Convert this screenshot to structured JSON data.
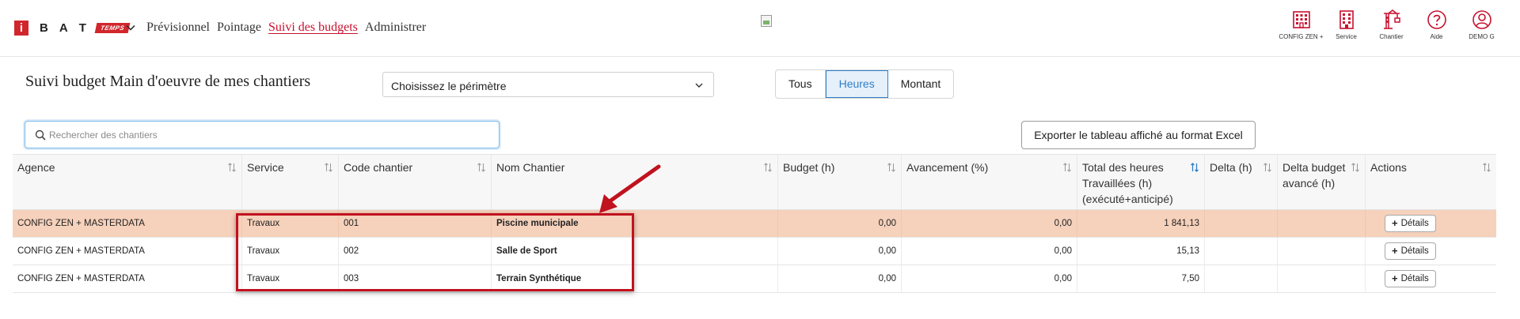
{
  "header": {
    "logo": {
      "i": "i",
      "letters": [
        "B",
        "A",
        "T"
      ],
      "badge": "TEMPS"
    },
    "nav": [
      {
        "label": "Prévisionnel",
        "active": false
      },
      {
        "label": "Pointage",
        "active": false
      },
      {
        "label": "Suivi des budgets",
        "active": true
      },
      {
        "label": "Administrer",
        "active": false
      }
    ],
    "tools": [
      {
        "icon": "building-icon",
        "label": "CONFIG ZEN +"
      },
      {
        "icon": "office-building-icon",
        "label": "Service"
      },
      {
        "icon": "crane-icon",
        "label": "Chantier"
      },
      {
        "icon": "help-icon",
        "label": "Aide"
      },
      {
        "icon": "user-icon",
        "label": "DEMO G"
      }
    ],
    "accent_color": "#c8102e"
  },
  "page": {
    "title": "Suivi budget Main d'oeuvre de mes chantiers",
    "perimeter_select": {
      "value": "Choisissez le périmètre"
    },
    "segments": [
      {
        "label": "Tous",
        "active": false
      },
      {
        "label": "Heures",
        "active": true
      },
      {
        "label": "Montant",
        "active": false
      }
    ],
    "search": {
      "placeholder": "Rechercher des chantiers",
      "value": ""
    },
    "export_label": "Exporter le tableau affiché au format Excel"
  },
  "table": {
    "columns": [
      {
        "label": "Agence",
        "sort": "both"
      },
      {
        "label": "Service",
        "sort": "both"
      },
      {
        "label": "Code chantier",
        "sort": "both"
      },
      {
        "label": "Nom Chantier",
        "sort": "both"
      },
      {
        "label": "Budget (h)",
        "sort": "both"
      },
      {
        "label": "Avancement (%)",
        "sort": "both"
      },
      {
        "label": "Total des heures Travaillées (h) (exécuté+anticipé)",
        "sort": "active"
      },
      {
        "label": "Delta (h)",
        "sort": "both"
      },
      {
        "label": "Delta budget avancé (h)",
        "sort": "both"
      },
      {
        "label": "Actions",
        "sort": "both"
      }
    ],
    "rows": [
      {
        "agence": "CONFIG ZEN + MASTERDATA",
        "service": "Travaux",
        "code": "001",
        "nom": "Piscine municipale",
        "budget": "0,00",
        "avancement": "0,00",
        "total": "1 841,13",
        "delta": "",
        "delta_budget": "",
        "action": "Détails",
        "highlighted": true
      },
      {
        "agence": "CONFIG ZEN + MASTERDATA",
        "service": "Travaux",
        "code": "002",
        "nom": "Salle de Sport",
        "budget": "0,00",
        "avancement": "0,00",
        "total": "15,13",
        "delta": "",
        "delta_budget": "",
        "action": "Détails",
        "highlighted": false
      },
      {
        "agence": "CONFIG ZEN + MASTERDATA",
        "service": "Travaux",
        "code": "003",
        "nom": "Terrain Synthétique",
        "budget": "0,00",
        "avancement": "0,00",
        "total": "7,50",
        "delta": "",
        "delta_budget": "",
        "action": "Détails",
        "highlighted": false
      }
    ]
  }
}
